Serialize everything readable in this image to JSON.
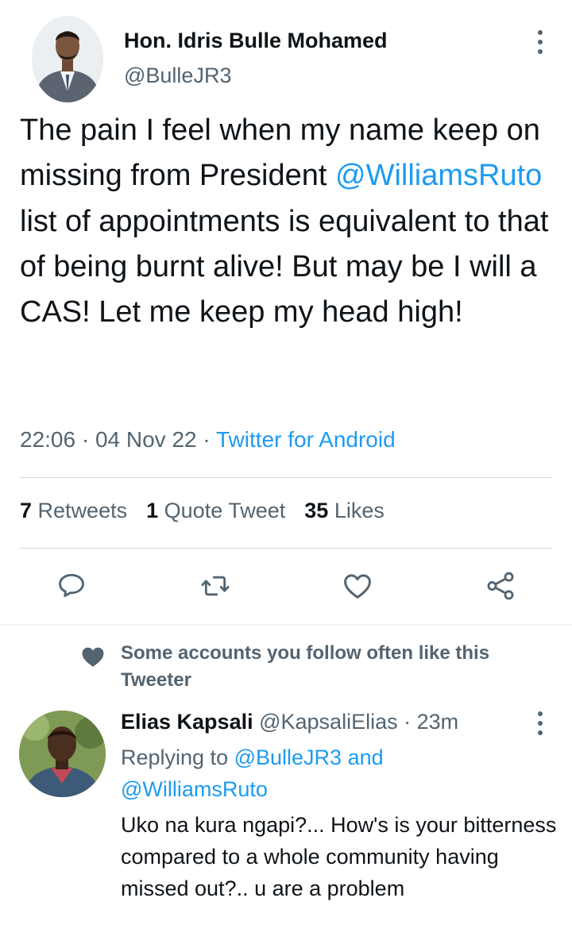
{
  "tweet": {
    "author_name": "Hon. Idris Bulle Mohamed",
    "author_handle": "@BulleJR3",
    "text_part1": "The pain I feel when my name keep on missing from President ",
    "text_mention": "@WilliamsRuto",
    "text_part2": " list of appointments is equivalent to that of being burnt alive! But may be I will a CAS! Let me keep my head high!",
    "time": "22:06",
    "date": "04 Nov 22",
    "separator": "·",
    "source": "Twitter for Android"
  },
  "stats": {
    "retweets_count": "7",
    "retweets_label": "Retweets",
    "quotes_count": "1",
    "quotes_label": "Quote Tweet",
    "likes_count": "35",
    "likes_label": "Likes"
  },
  "actions": {
    "reply_icon": "reply-icon",
    "retweet_icon": "retweet-icon",
    "like_icon": "heart-icon",
    "share_icon": "share-icon"
  },
  "social_context": {
    "text": "Some accounts you follow often like this Tweeter"
  },
  "reply": {
    "author_name": "Elias Kapsali",
    "author_handle": "@KapsaliElias",
    "separator": "·",
    "age": "23m",
    "replying_label": "Replying to ",
    "replying_to_1": "@BulleJR3",
    "replying_and": " and",
    "replying_to_2": "@WilliamsRuto",
    "text": "Uko na kura ngapi?... How's is your bitterness compared to a whole community having missed out?.. u are a problem"
  },
  "colors": {
    "accent": "#1d9bf0",
    "text_primary": "#0f1419",
    "text_secondary": "#536471",
    "divider": "#cfd9de"
  }
}
